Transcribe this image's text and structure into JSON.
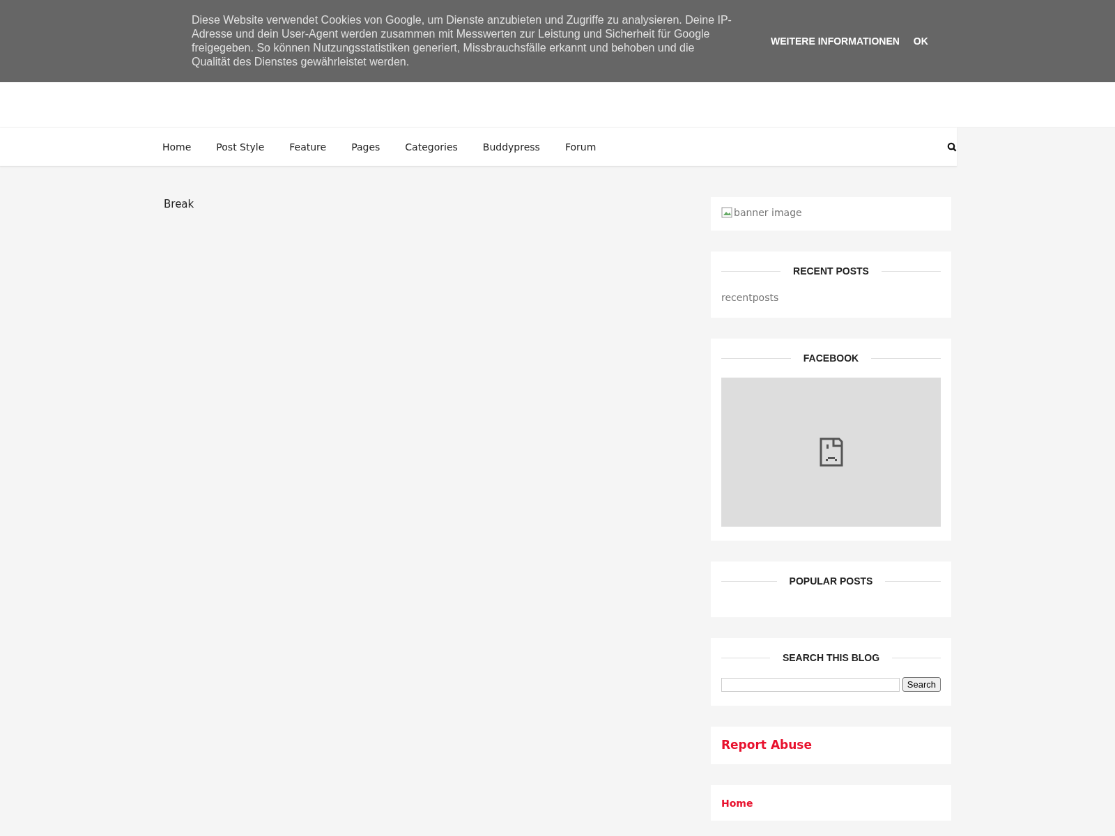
{
  "cookie_banner": {
    "text": "Diese Website verwendet Cookies von Google, um Dienste anzubieten und Zugriffe zu analysieren. Deine IP-Adresse und dein User-Agent werden zusammen mit Messwerten zur Leistung und Sicherheit für Google freigegeben. So können Nutzungsstatistiken generiert, Missbrauchsfälle erkannt und behoben und die Qualität des Dienstes gewährleistet werden.",
    "buttons": [
      "WEITERE INFORMATIONEN",
      "OK"
    ]
  },
  "nav": {
    "items": [
      "Home",
      "Post Style",
      "Feature",
      "Pages",
      "Categories",
      "Buddypress",
      "Forum"
    ]
  },
  "main": {
    "text": "Break"
  },
  "sidebar": {
    "widgets": [
      {
        "kind": "image",
        "alt": "banner image"
      },
      {
        "kind": "titled",
        "title": "RECENT POSTS",
        "body": "recentposts"
      },
      {
        "kind": "frame",
        "title": "FACEBOOK"
      },
      {
        "kind": "titled",
        "title": "POPULAR POSTS"
      },
      {
        "kind": "search",
        "title": "SEARCH THIS BLOG",
        "button": "Search"
      },
      {
        "kind": "heading",
        "text": "Report Abuse"
      },
      {
        "kind": "link",
        "text": "Home"
      }
    ]
  }
}
